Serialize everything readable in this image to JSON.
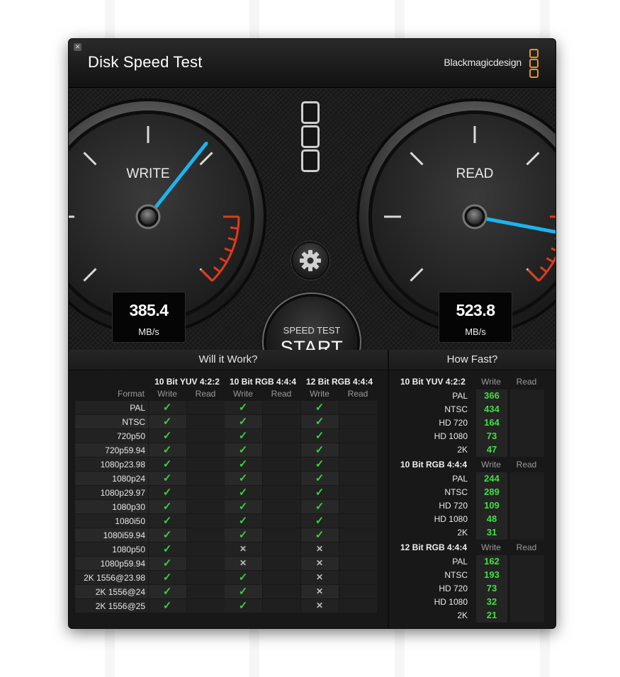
{
  "window": {
    "title": "Disk Speed Test",
    "brand": "Blackmagicdesign",
    "accent_color": "#e8922c"
  },
  "write_gauge": {
    "label": "WRITE",
    "value": "385.4",
    "unit": "MB/s",
    "needle_color": "#1ab5f0",
    "redzone_color": "#e03a1a"
  },
  "read_gauge": {
    "label": "READ",
    "value": "523.8",
    "unit": "MB/s",
    "needle_color": "#1ab5f0",
    "redzone_color": "#e03a1a"
  },
  "controls": {
    "settings_icon": "gear-icon",
    "start_small": "SPEED TEST",
    "start_big": "START"
  },
  "will_it_work": {
    "title": "Will it Work?",
    "format_header": "Format",
    "write_header": "Write",
    "read_header": "Read",
    "columns": [
      "10 Bit YUV 4:2:2",
      "10 Bit RGB 4:4:4",
      "12 Bit RGB 4:4:4"
    ],
    "rows": [
      {
        "format": "PAL",
        "results": [
          "check",
          "check",
          "check"
        ]
      },
      {
        "format": "NTSC",
        "results": [
          "check",
          "check",
          "check"
        ]
      },
      {
        "format": "720p50",
        "results": [
          "check",
          "check",
          "check"
        ]
      },
      {
        "format": "720p59.94",
        "results": [
          "check",
          "check",
          "check"
        ]
      },
      {
        "format": "1080p23.98",
        "results": [
          "check",
          "check",
          "check"
        ]
      },
      {
        "format": "1080p24",
        "results": [
          "check",
          "check",
          "check"
        ]
      },
      {
        "format": "1080p29.97",
        "results": [
          "check",
          "check",
          "check"
        ]
      },
      {
        "format": "1080p30",
        "results": [
          "check",
          "check",
          "check"
        ]
      },
      {
        "format": "1080i50",
        "results": [
          "check",
          "check",
          "check"
        ]
      },
      {
        "format": "1080i59.94",
        "results": [
          "check",
          "check",
          "check"
        ]
      },
      {
        "format": "1080p50",
        "results": [
          "check",
          "cross",
          "cross"
        ]
      },
      {
        "format": "1080p59.94",
        "results": [
          "check",
          "cross",
          "cross"
        ]
      },
      {
        "format": "2K 1556@23.98",
        "results": [
          "check",
          "check",
          "cross"
        ]
      },
      {
        "format": "2K 1556@24",
        "results": [
          "check",
          "check",
          "cross"
        ]
      },
      {
        "format": "2K 1556@25",
        "results": [
          "check",
          "check",
          "cross"
        ]
      }
    ]
  },
  "how_fast": {
    "title": "How Fast?",
    "write_header": "Write",
    "read_header": "Read",
    "groups": [
      {
        "name": "10 Bit YUV 4:2:2",
        "rows": [
          {
            "label": "PAL",
            "write": "366"
          },
          {
            "label": "NTSC",
            "write": "434"
          },
          {
            "label": "HD 720",
            "write": "164"
          },
          {
            "label": "HD 1080",
            "write": "73"
          },
          {
            "label": "2K",
            "write": "47"
          }
        ]
      },
      {
        "name": "10 Bit RGB 4:4:4",
        "rows": [
          {
            "label": "PAL",
            "write": "244"
          },
          {
            "label": "NTSC",
            "write": "289"
          },
          {
            "label": "HD 720",
            "write": "109"
          },
          {
            "label": "HD 1080",
            "write": "48"
          },
          {
            "label": "2K",
            "write": "31"
          }
        ]
      },
      {
        "name": "12 Bit RGB 4:4:4",
        "rows": [
          {
            "label": "PAL",
            "write": "162"
          },
          {
            "label": "NTSC",
            "write": "193"
          },
          {
            "label": "HD 720",
            "write": "73"
          },
          {
            "label": "HD 1080",
            "write": "32"
          },
          {
            "label": "2K",
            "write": "21"
          }
        ]
      }
    ]
  }
}
